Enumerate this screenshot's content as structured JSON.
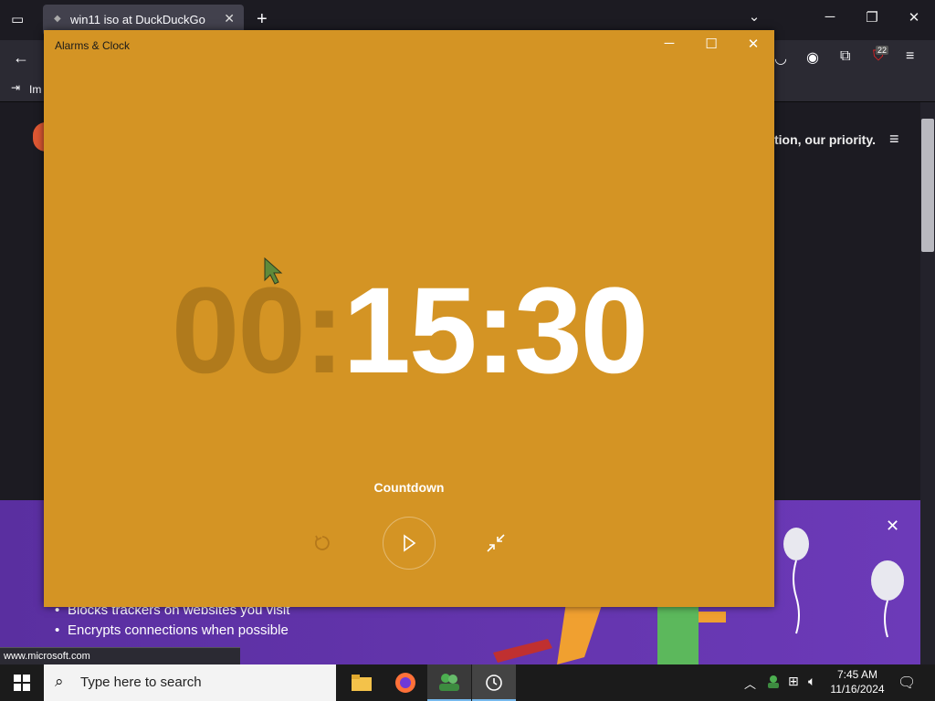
{
  "browser": {
    "tab_title": "win11 iso at DuckDuckGo",
    "tab_close": "✕",
    "new_tab": "+",
    "bookmark_label": "Im",
    "badge_count": "22",
    "content_tagline": "tion, our priority.",
    "promo_items": [
      "Blocks trackers on websites you visit",
      "Encrypts connections when possible"
    ],
    "status_url": "www.microsoft.com"
  },
  "alarms": {
    "title": "Alarms & Clock",
    "timer_hours": "00:",
    "timer_rest": "15:30",
    "label": "Countdown"
  },
  "taskbar": {
    "search_placeholder": "Type here to search",
    "time": "7:45 AM",
    "date": "11/16/2024"
  },
  "colors": {
    "accent": "#d49424",
    "promo": "#6c3ab8"
  }
}
